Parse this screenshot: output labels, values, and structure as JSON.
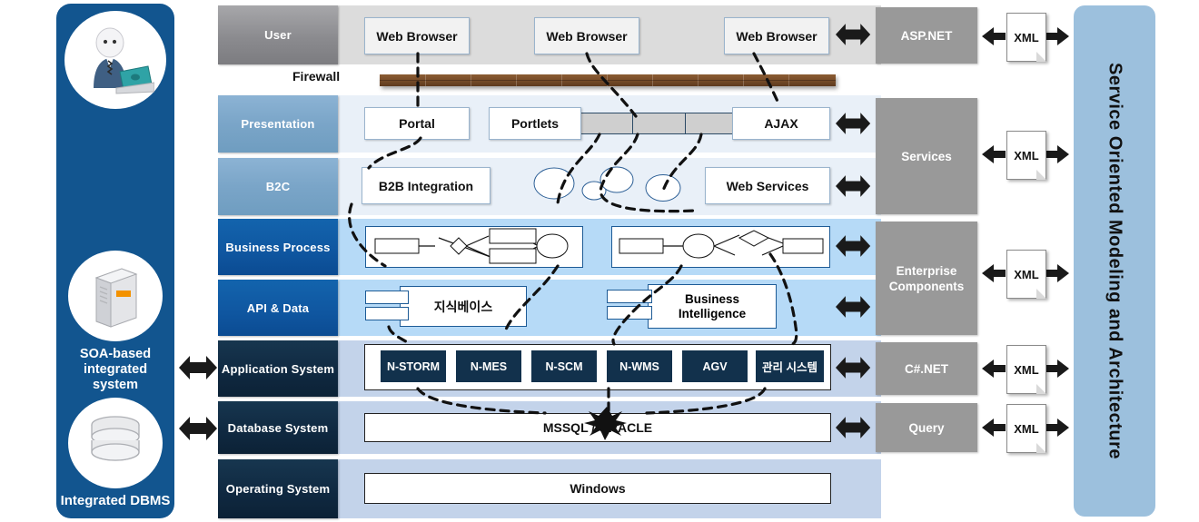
{
  "diagram": {
    "banner_right": "Service Oriented Modeling and Architecture",
    "firewall_label": "Firewall"
  },
  "left_rail": {
    "icons": [
      {
        "name": "user-avatar-icon",
        "label": ""
      },
      {
        "name": "server-icon",
        "label": "SOA-based\nintegrated\nsystem"
      },
      {
        "name": "database-icon",
        "label": "Integrated DBMS"
      }
    ],
    "soa_label_line1": "SOA-based",
    "soa_label_line2": "integrated",
    "soa_label_line3": "system",
    "dbms_label": "Integrated DBMS"
  },
  "layers": [
    {
      "id": "user",
      "label": "User"
    },
    {
      "id": "presentation",
      "label": "Presentation"
    },
    {
      "id": "b2c",
      "label": "B2C"
    },
    {
      "id": "business",
      "label": "Business  Process"
    },
    {
      "id": "api",
      "label": "API & Data"
    },
    {
      "id": "application",
      "label": "Application  System"
    },
    {
      "id": "database",
      "label": "Database  System"
    },
    {
      "id": "os",
      "label": "Operating  System"
    }
  ],
  "nodes": {
    "user_row": [
      "Web Browser",
      "Web Browser",
      "Web Browser"
    ],
    "presentation_row": [
      "Portal",
      "Portlets",
      "AJAX"
    ],
    "b2c_row": [
      "B2B Integration",
      "Web Services"
    ],
    "api_row": [
      "지식베이스",
      "Business\nIntelligence"
    ],
    "api_row_1": "지식베이스",
    "api_row_2a": "Business",
    "api_row_2b": "Intelligence",
    "application_row": [
      "N-STORM",
      "N-MES",
      "N-SCM",
      "N-WMS",
      "AGV",
      "관리 시스템"
    ],
    "database_row": "MSSQL / ORACLE",
    "os_row": "Windows"
  },
  "right_column": [
    {
      "id": "aspnet",
      "label": "ASP.NET"
    },
    {
      "id": "services",
      "label": "Services"
    },
    {
      "id": "enterprise",
      "label": "Enterprise\nComponents"
    },
    {
      "id": "enterprise_l1",
      "label": "Enterprise"
    },
    {
      "id": "enterprise_l2",
      "label": "Components"
    },
    {
      "id": "csharpnet",
      "label": "C#.NET"
    },
    {
      "id": "query",
      "label": "Query"
    }
  ],
  "right_col_labels": {
    "aspnet": "ASP.NET",
    "services": "Services",
    "enterprise_1": "Enterprise",
    "enterprise_2": "Components",
    "csharp": "C#.NET",
    "query": "Query"
  },
  "xml_docs": [
    "XML",
    "XML",
    "XML",
    "XML",
    "XML"
  ],
  "colors": {
    "rail_blue": "#12558f",
    "band_user": "#dcdcdc",
    "band_pale": "#e9f0f8",
    "band_blue": "#b6daf7",
    "band_steel": "#c3d3ea",
    "service_gray": "#999999",
    "banner_blue": "#9cc0dd",
    "dark_navy": "#12314c",
    "firewall_brown": "#7a4e2a"
  }
}
